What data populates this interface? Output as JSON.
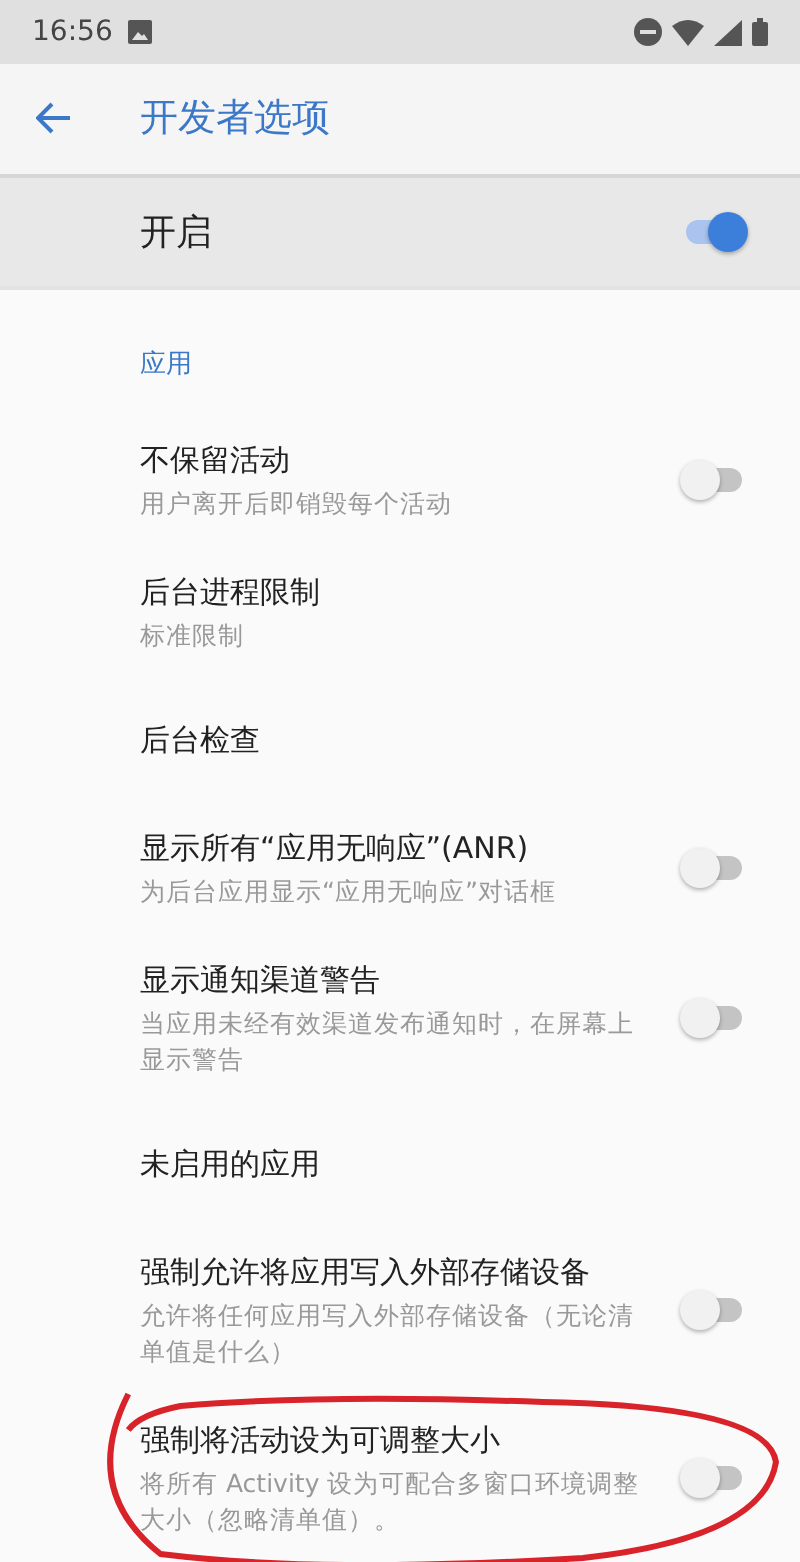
{
  "status_bar": {
    "time": "16:56"
  },
  "toolbar": {
    "title": "开发者选项"
  },
  "master_switch": {
    "label": "开启",
    "on": true
  },
  "category": "应用",
  "items": [
    {
      "kind": "switch",
      "title": "不保留活动",
      "summary": "用户离开后即销毁每个活动",
      "on": false,
      "circled": false
    },
    {
      "kind": "plain",
      "title": "后台进程限制",
      "summary": "标准限制",
      "circled": false
    },
    {
      "kind": "plain",
      "title": "后台检查",
      "circled": false
    },
    {
      "kind": "switch",
      "title": "显示所有“应用无响应”(ANR)",
      "summary": "为后台应用显示“应用无响应”对话框",
      "on": false,
      "circled": false
    },
    {
      "kind": "switch",
      "title": "显示通知渠道警告",
      "summary": "当应用未经有效渠道发布通知时，在屏幕上显示警告",
      "on": false,
      "circled": false
    },
    {
      "kind": "plain",
      "title": "未启用的应用",
      "circled": false
    },
    {
      "kind": "switch",
      "title": "强制允许将应用写入外部存储设备",
      "summary": "允许将任何应用写入外部存储设备（无论清单值是什么）",
      "on": false,
      "circled": false
    },
    {
      "kind": "switch",
      "title": "强制将活动设为可调整大小",
      "summary": "将所有 Activity 设为可配合多窗口环境调整大小（忽略清单值）。",
      "on": false,
      "circled": true
    }
  ]
}
